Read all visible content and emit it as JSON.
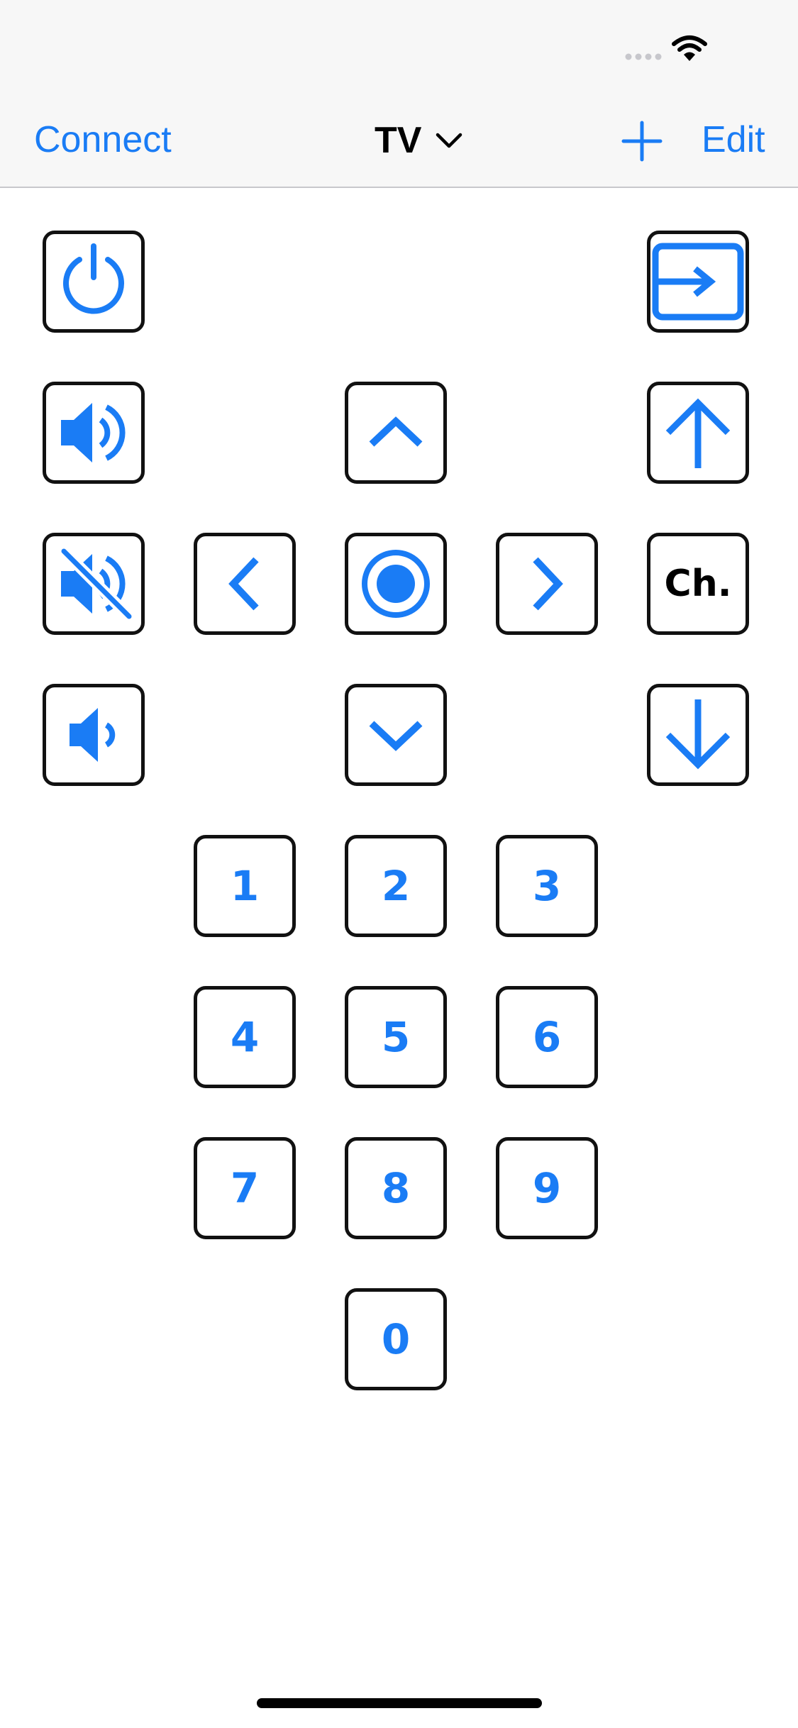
{
  "status_bar": {
    "icons": [
      "cellular-signal-icon",
      "wifi-icon"
    ]
  },
  "nav": {
    "connect_label": "Connect",
    "title": "TV",
    "title_icon": "chevron-down-icon",
    "add_icon": "plus-icon",
    "edit_label": "Edit"
  },
  "remote": {
    "buttons": [
      {
        "name": "power-button",
        "icon": "power-icon"
      },
      {
        "name": "input-button",
        "icon": "input-source-icon"
      },
      {
        "name": "volume-up-button",
        "icon": "speaker-loud-icon"
      },
      {
        "name": "nav-up-button",
        "icon": "chevron-up-icon"
      },
      {
        "name": "channel-up-button",
        "icon": "arrow-up-icon"
      },
      {
        "name": "mute-button",
        "icon": "speaker-mute-icon"
      },
      {
        "name": "nav-left-button",
        "icon": "chevron-left-icon"
      },
      {
        "name": "ok-button",
        "icon": "ok-circle-icon"
      },
      {
        "name": "nav-right-button",
        "icon": "chevron-right-icon"
      },
      {
        "name": "volume-down-button",
        "icon": "speaker-quiet-icon"
      },
      {
        "name": "nav-down-button",
        "icon": "chevron-down-icon"
      },
      {
        "name": "channel-down-button",
        "icon": "arrow-down-icon"
      }
    ],
    "channel_label": "Ch.",
    "digits": [
      "1",
      "2",
      "3",
      "4",
      "5",
      "6",
      "7",
      "8",
      "9",
      "0"
    ]
  },
  "colors": {
    "accent": "#1a7cf5",
    "button_border": "#111111",
    "nav_background": "#f7f7f7"
  }
}
